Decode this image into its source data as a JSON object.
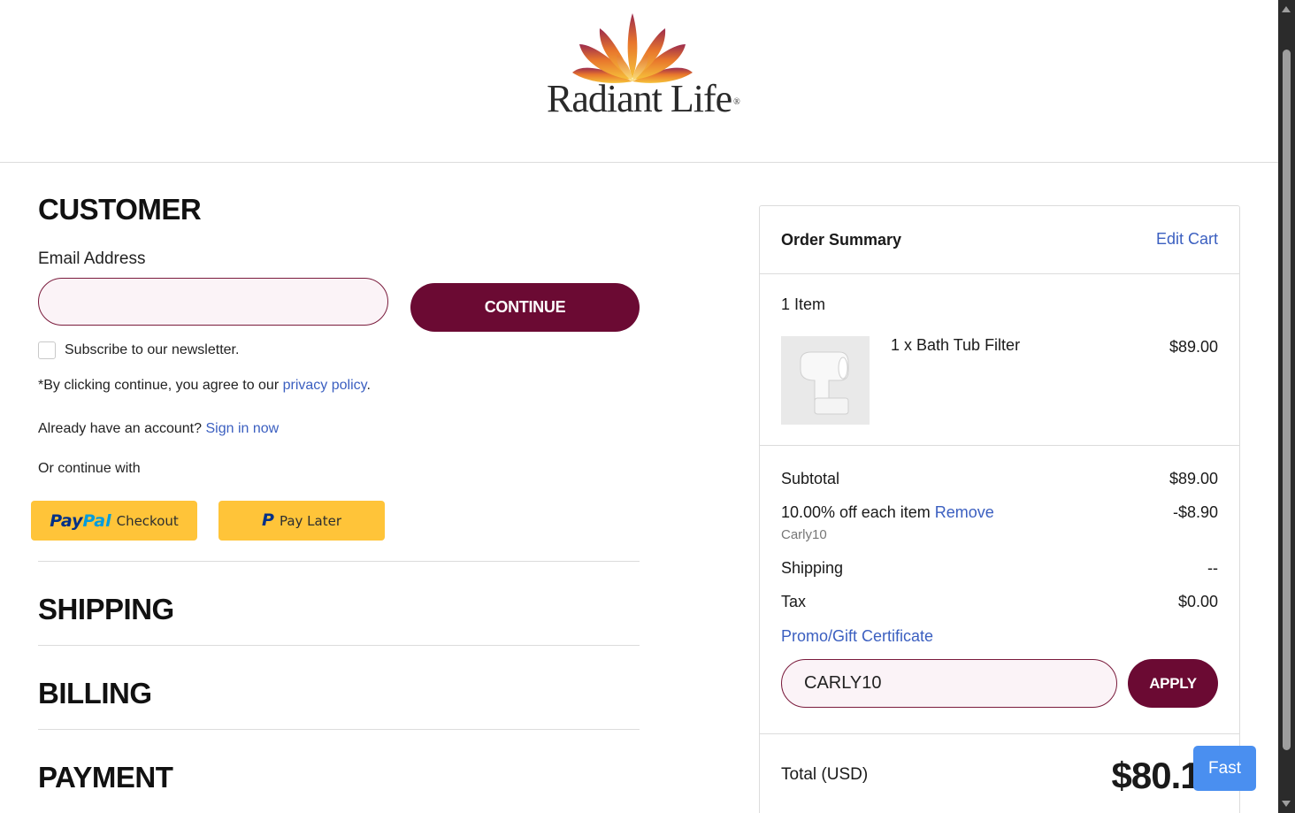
{
  "brand": {
    "name": "Radiant Life",
    "reg": "®"
  },
  "customer": {
    "title": "CUSTOMER",
    "email_label": "Email Address",
    "email_value": "",
    "continue_label": "CONTINUE",
    "newsletter_label": "Subscribe to our newsletter.",
    "terms_prefix": "*By clicking continue, you agree to our ",
    "terms_link": "privacy policy",
    "terms_suffix": ".",
    "account_prefix": "Already have an account? ",
    "account_link": "Sign in now",
    "or_continue": "Or continue with",
    "paypal_pay": "Pay",
    "paypal_pal": "Pal",
    "paypal_checkout": "Checkout",
    "paypal_later": "Pay Later"
  },
  "sections": {
    "shipping": "SHIPPING",
    "billing": "BILLING",
    "payment": "PAYMENT"
  },
  "order_summary": {
    "title": "Order Summary",
    "edit_cart": "Edit Cart",
    "item_count": "1 Item",
    "items": [
      {
        "name": "1 x Bath Tub Filter",
        "price": "$89.00"
      }
    ],
    "subtotal_label": "Subtotal",
    "subtotal_value": "$89.00",
    "discount_label": "10.00% off each item",
    "discount_remove": "Remove",
    "discount_value": "-$8.90",
    "discount_code": "Carly10",
    "shipping_label": "Shipping",
    "shipping_value": "--",
    "tax_label": "Tax",
    "tax_value": "$0.00",
    "promo_label": "Promo/Gift Certificate",
    "promo_value": "CARLY10",
    "apply_label": "APPLY",
    "total_label": "Total (USD)",
    "total_value": "$80.10"
  },
  "fast_button": "Fast",
  "colors": {
    "accent": "#6b0a33",
    "link": "#3b5fc0",
    "paypal": "#ffc439",
    "fast": "#4a8ff0"
  }
}
